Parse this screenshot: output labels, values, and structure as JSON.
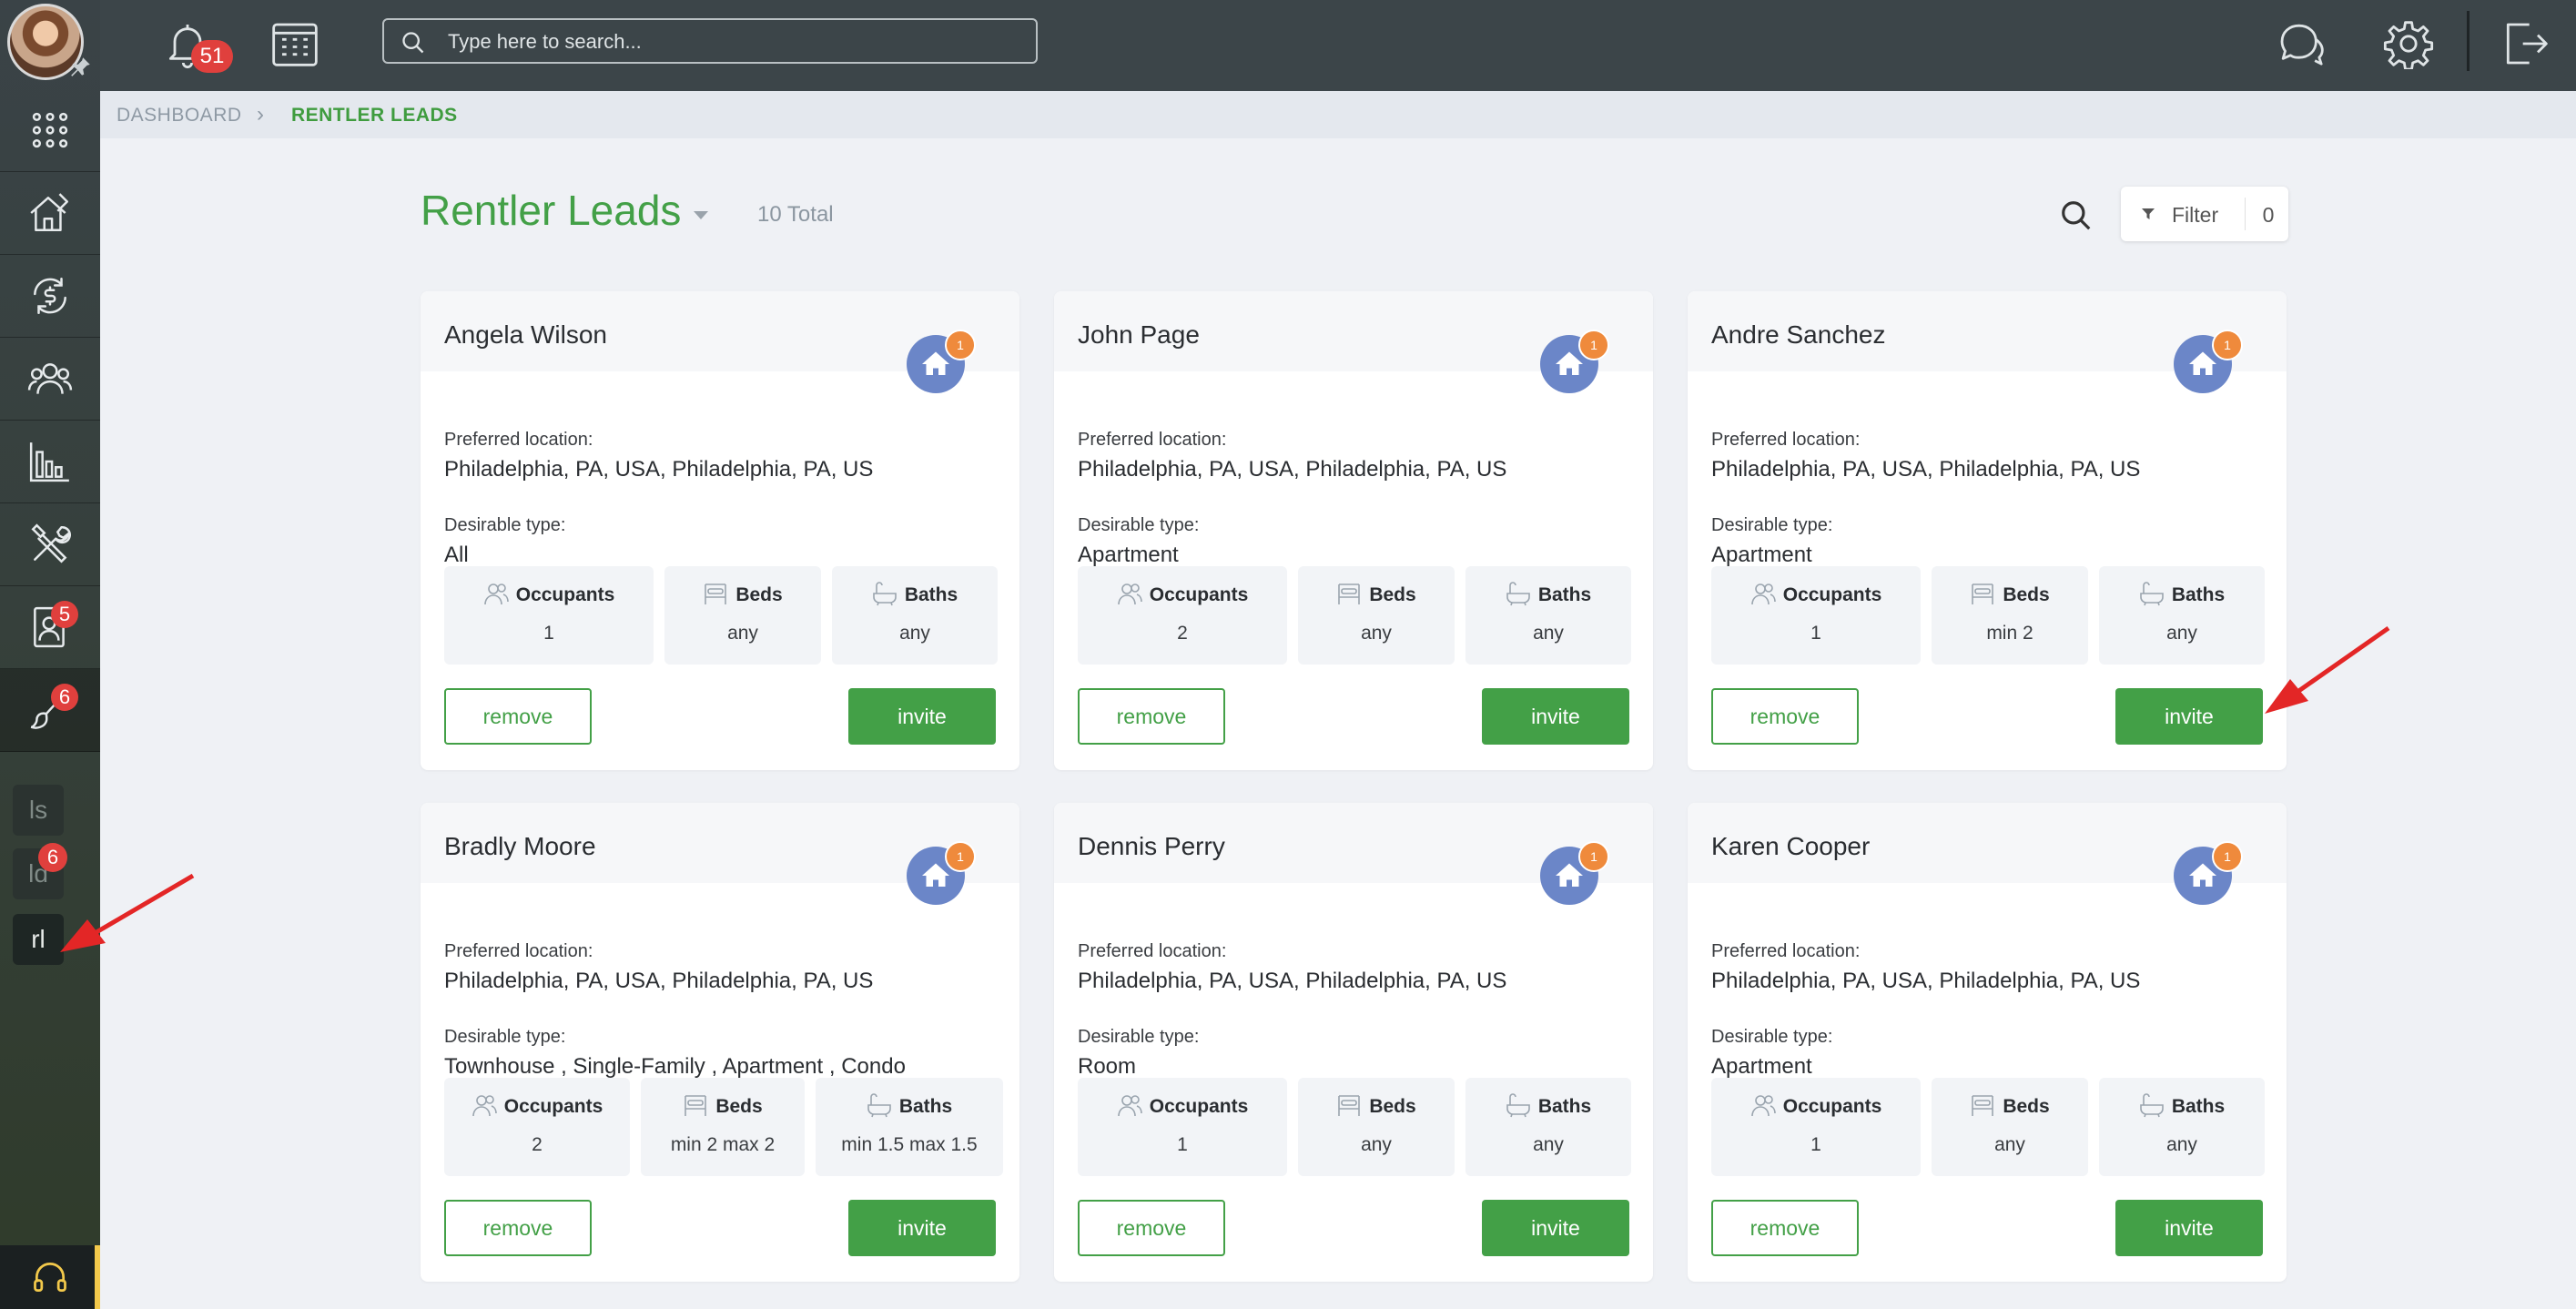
{
  "topbar": {
    "notification_count": "51",
    "search_placeholder": "Type here to search..."
  },
  "sidebar": {
    "badges": {
      "applications": "5",
      "leads_tool": "6"
    },
    "mini_items": [
      {
        "label": "ls",
        "badge": ""
      },
      {
        "label": "ld",
        "badge": "6"
      },
      {
        "label": "rl",
        "badge": ""
      }
    ]
  },
  "breadcrumb": {
    "root": "DASHBOARD",
    "separator": "›",
    "current": "RENTLER LEADS"
  },
  "header": {
    "title": "Rentler Leads",
    "total": "10 Total",
    "filter_label": "Filter",
    "filter_count": "0"
  },
  "labels": {
    "preferred_location": "Preferred location:",
    "desirable_type": "Desirable type:",
    "occupants": "Occupants",
    "beds": "Beds",
    "baths": "Baths",
    "remove": "remove",
    "invite": "invite"
  },
  "leads": [
    {
      "name": "Angela Wilson",
      "badge": "1",
      "location": "Philadelphia, PA, USA, Philadelphia, PA, US",
      "type": "All",
      "occupants": "1",
      "beds": "any",
      "baths": "any"
    },
    {
      "name": "John Page",
      "badge": "1",
      "location": "Philadelphia, PA, USA, Philadelphia, PA, US",
      "type": "Apartment",
      "occupants": "2",
      "beds": "any",
      "baths": "any"
    },
    {
      "name": "Andre Sanchez",
      "badge": "1",
      "location": "Philadelphia, PA, USA, Philadelphia, PA, US",
      "type": "Apartment",
      "occupants": "1",
      "beds": "min 2",
      "baths": "any"
    },
    {
      "name": "Bradly Moore",
      "badge": "1",
      "location": "Philadelphia, PA, USA, Philadelphia, PA, US",
      "type": "Townhouse , Single-Family , Apartment , Condo",
      "occupants": "2",
      "beds": "min 2 max 2",
      "baths": "min 1.5 max 1.5"
    },
    {
      "name": "Dennis Perry",
      "badge": "1",
      "location": "Philadelphia, PA, USA, Philadelphia, PA, US",
      "type": "Room",
      "occupants": "1",
      "beds": "any",
      "baths": "any"
    },
    {
      "name": "Karen Cooper",
      "badge": "1",
      "location": "Philadelphia, PA, USA, Philadelphia, PA, US",
      "type": "Apartment",
      "occupants": "1",
      "beds": "any",
      "baths": "any"
    }
  ],
  "colors": {
    "accent_green": "#43a047",
    "topbar": "#3c4549",
    "badge_red": "#e0403d",
    "house_blue": "#6b86c8",
    "house_badge_orange": "#ef8a3c",
    "annotation_arrow": "#e32626"
  }
}
